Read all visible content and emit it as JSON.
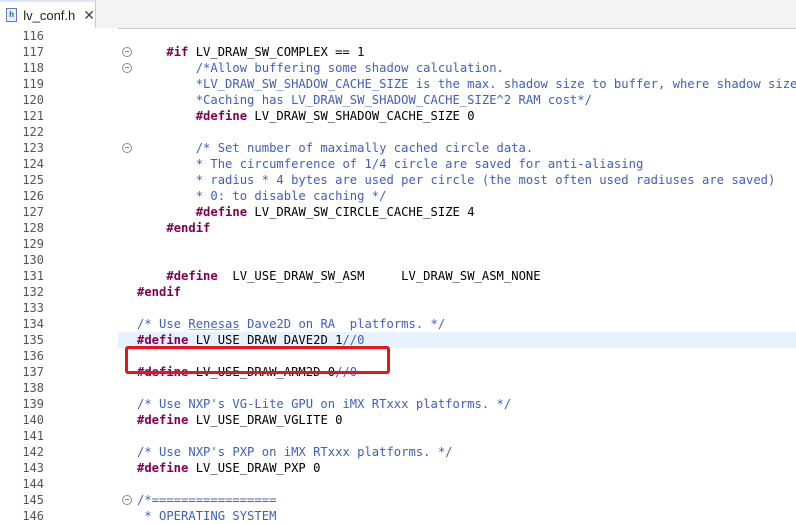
{
  "tab": {
    "filename": "lv_conf.h",
    "file_icon": "h-file-icon",
    "close_glyph": "✕"
  },
  "accent_colors": {
    "preprocessor": "#7f0055",
    "comment": "#3f5fbf",
    "highlight_box": "#e8141b",
    "current_line": "#e8f2fe"
  },
  "lines": [
    {
      "n": "116",
      "parts": []
    },
    {
      "n": "117",
      "fold": "⊖",
      "parts": [
        {
          "t": "    ",
          "c": ""
        },
        {
          "t": "#if",
          "c": "pp"
        },
        {
          "t": " LV_DRAW_SW_COMPLEX == 1",
          "c": ""
        }
      ]
    },
    {
      "n": "118",
      "fold": "⊖",
      "parts": [
        {
          "t": "        /*Allow buffering some shadow calculation.",
          "c": "cm"
        }
      ]
    },
    {
      "n": "119",
      "parts": [
        {
          "t": "        *LV_DRAW_SW_SHADOW_CACHE_SIZE is the max. shadow size to buffer, where shadow size i",
          "c": "cm"
        }
      ]
    },
    {
      "n": "120",
      "parts": [
        {
          "t": "        *Caching has LV_DRAW_SW_SHADOW_CACHE_SIZE^2 RAM cost*/",
          "c": "cm"
        }
      ]
    },
    {
      "n": "121",
      "parts": [
        {
          "t": "        ",
          "c": ""
        },
        {
          "t": "#define",
          "c": "pp"
        },
        {
          "t": " LV_DRAW_SW_SHADOW_CACHE_SIZE 0",
          "c": ""
        }
      ]
    },
    {
      "n": "122",
      "parts": []
    },
    {
      "n": "123",
      "fold": "⊖",
      "parts": [
        {
          "t": "        /* Set number of maximally cached circle data.",
          "c": "cm"
        }
      ]
    },
    {
      "n": "124",
      "parts": [
        {
          "t": "        * The circumference of 1/4 circle are saved for anti-aliasing",
          "c": "cm"
        }
      ]
    },
    {
      "n": "125",
      "parts": [
        {
          "t": "        * radius * 4 bytes are used per circle (the most often used radiuses are saved)",
          "c": "cm"
        }
      ]
    },
    {
      "n": "126",
      "parts": [
        {
          "t": "        * 0: to disable caching */",
          "c": "cm"
        }
      ]
    },
    {
      "n": "127",
      "parts": [
        {
          "t": "        ",
          "c": ""
        },
        {
          "t": "#define",
          "c": "pp"
        },
        {
          "t": " LV_DRAW_SW_CIRCLE_CACHE_SIZE 4",
          "c": ""
        }
      ]
    },
    {
      "n": "128",
      "parts": [
        {
          "t": "    ",
          "c": ""
        },
        {
          "t": "#endif",
          "c": "pp"
        }
      ]
    },
    {
      "n": "129",
      "parts": []
    },
    {
      "n": "130",
      "parts": []
    },
    {
      "n": "131",
      "parts": [
        {
          "t": "    ",
          "c": ""
        },
        {
          "t": "#define",
          "c": "pp"
        },
        {
          "t": "  LV_USE_DRAW_SW_ASM     LV_DRAW_SW_ASM_NONE",
          "c": ""
        }
      ]
    },
    {
      "n": "132",
      "parts": [
        {
          "t": "#endif",
          "c": "pp"
        }
      ]
    },
    {
      "n": "133",
      "parts": []
    },
    {
      "n": "134",
      "parts": [
        {
          "t": "/* Use ",
          "c": "cm"
        },
        {
          "t": "Renesas",
          "c": "cm underline"
        },
        {
          "t": " Dave2D on RA  platforms. */",
          "c": "cm"
        }
      ]
    },
    {
      "n": "135",
      "current": true,
      "parts": [
        {
          "t": "#define",
          "c": "pp"
        },
        {
          "t": " LV_USE_DRAW_DAVE2D 1",
          "c": ""
        },
        {
          "t": "//0",
          "c": "cm"
        }
      ]
    },
    {
      "n": "136",
      "parts": []
    },
    {
      "n": "137",
      "parts": [
        {
          "t": "#define",
          "c": "pp"
        },
        {
          "t": " LV_USE_DRAW_ARM2D 0",
          "c": ""
        },
        {
          "t": "//0",
          "c": "cm"
        }
      ]
    },
    {
      "n": "138",
      "parts": []
    },
    {
      "n": "139",
      "parts": [
        {
          "t": "/* Use NXP's VG-Lite GPU on iMX RTxxx platforms. */",
          "c": "cm"
        }
      ]
    },
    {
      "n": "140",
      "parts": [
        {
          "t": "#define",
          "c": "pp"
        },
        {
          "t": " LV_USE_DRAW_VGLITE 0",
          "c": ""
        }
      ]
    },
    {
      "n": "141",
      "parts": []
    },
    {
      "n": "142",
      "parts": [
        {
          "t": "/* Use NXP's PXP on iMX RTxxx platforms. */",
          "c": "cm"
        }
      ]
    },
    {
      "n": "143",
      "parts": [
        {
          "t": "#define",
          "c": "pp"
        },
        {
          "t": " LV_USE_DRAW_PXP 0",
          "c": ""
        }
      ]
    },
    {
      "n": "144",
      "parts": []
    },
    {
      "n": "145",
      "fold": "⊖",
      "parts": [
        {
          "t": "/*=================",
          "c": "cm"
        }
      ]
    },
    {
      "n": "146",
      "parts": [
        {
          "t": " * OPERATING SYSTEM",
          "c": "cm"
        }
      ]
    }
  ]
}
